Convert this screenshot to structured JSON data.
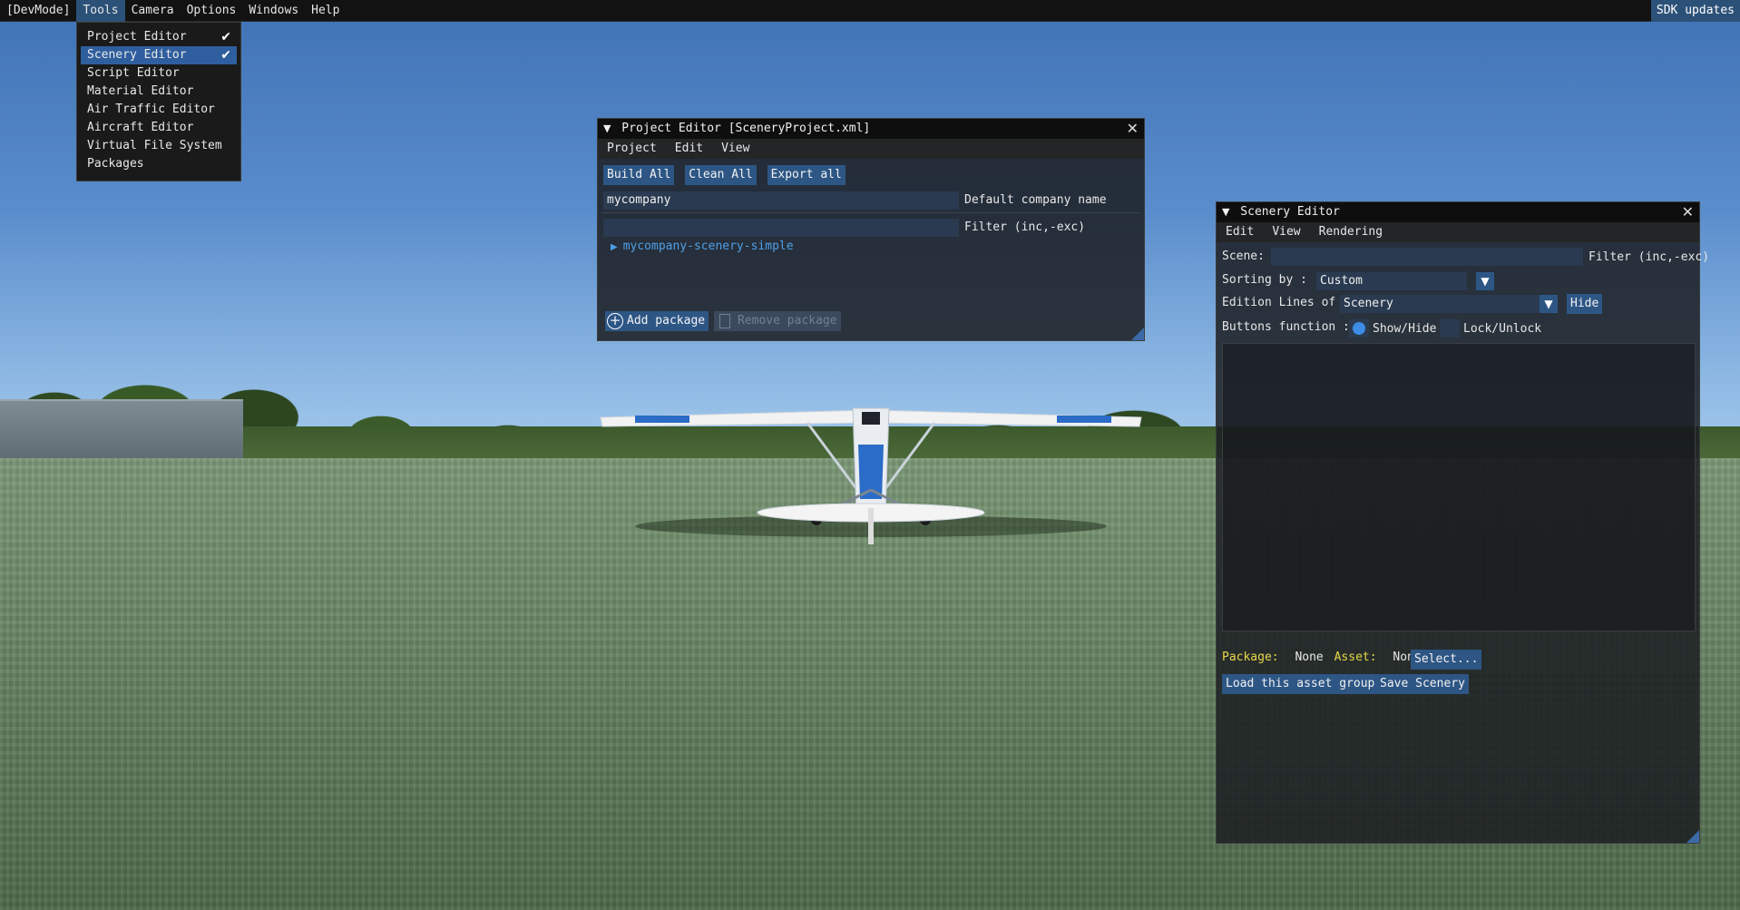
{
  "menubar": {
    "items": [
      "[DevMode]",
      "Tools",
      "Camera",
      "Options",
      "Windows",
      "Help"
    ],
    "active_index": 1,
    "right_label": "SDK updates"
  },
  "tools_menu": {
    "items": [
      {
        "label": "Project Editor",
        "checked": true,
        "highlighted": false
      },
      {
        "label": "Scenery Editor",
        "checked": true,
        "highlighted": true
      },
      {
        "label": "Script Editor",
        "checked": false,
        "highlighted": false
      },
      {
        "label": "Material Editor",
        "checked": false,
        "highlighted": false
      },
      {
        "label": "Air Traffic Editor",
        "checked": false,
        "highlighted": false
      },
      {
        "label": "Aircraft Editor",
        "checked": false,
        "highlighted": false
      },
      {
        "label": "Virtual File System",
        "checked": false,
        "highlighted": false
      },
      {
        "label": "Packages",
        "checked": false,
        "highlighted": false
      }
    ]
  },
  "project_editor": {
    "title": "Project Editor [SceneryProject.xml]",
    "menu": [
      "Project",
      "Edit",
      "View"
    ],
    "buttons": {
      "build_all": "Build All",
      "clean_all": "Clean All",
      "export_all": "Export all"
    },
    "company_field_value": "mycompany",
    "company_field_label": "Default company name",
    "filter_value": "",
    "filter_label": "Filter (inc,-exc)",
    "tree_item": "mycompany-scenery-simple",
    "add_package": "Add package",
    "remove_package": "Remove package"
  },
  "scenery_editor": {
    "title": "Scenery Editor",
    "menu": [
      "Edit",
      "View",
      "Rendering"
    ],
    "scene_label": "Scene:",
    "scene_value": "",
    "filter_label": "Filter (inc,-exc)",
    "sorting_label": "Sorting by :",
    "sorting_value": "Custom",
    "edition_label": "Edition Lines of",
    "edition_value": "Scenery",
    "hide_button": "Hide",
    "buttons_function_label": "Buttons function :",
    "show_hide": "Show/Hide",
    "lock_unlock": "Lock/Unlock",
    "package_label": "Package:",
    "package_value": "None",
    "asset_label": "Asset:",
    "asset_value": "None",
    "select_button": "Select...",
    "load_button": "Load this asset group",
    "save_button": "Save Scenery"
  },
  "colors": {
    "accent": "#2d5685",
    "highlight": "#2f5e9e",
    "label_yellow": "#e8d84a",
    "radio_blue": "#3d8de6"
  }
}
